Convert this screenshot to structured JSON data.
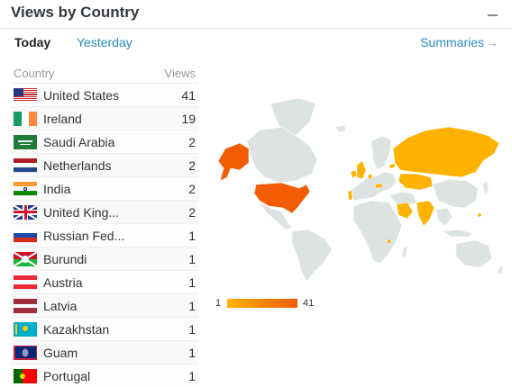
{
  "header": {
    "title": "Views by Country"
  },
  "tabs": [
    {
      "label": "Today",
      "active": true
    },
    {
      "label": "Yesterday",
      "active": false
    }
  ],
  "summaries_label": "Summaries",
  "table": {
    "columns": [
      "Country",
      "Views"
    ],
    "rows": [
      {
        "country": "United States",
        "views": "41",
        "flag": "us-flag-icon"
      },
      {
        "country": "Ireland",
        "views": "19",
        "flag": "ireland-flag-icon"
      },
      {
        "country": "Saudi Arabia",
        "views": "2",
        "flag": "saudi-arabia-flag-icon"
      },
      {
        "country": "Netherlands",
        "views": "2",
        "flag": "netherlands-flag-icon"
      },
      {
        "country": "India",
        "views": "2",
        "flag": "india-flag-icon"
      },
      {
        "country": "United King...",
        "views": "2",
        "flag": "uk-flag-icon"
      },
      {
        "country": "Russian Fed...",
        "views": "1",
        "flag": "russia-flag-icon"
      },
      {
        "country": "Burundi",
        "views": "1",
        "flag": "burundi-flag-icon"
      },
      {
        "country": "Austria",
        "views": "1",
        "flag": "austria-flag-icon"
      },
      {
        "country": "Latvia",
        "views": "1",
        "flag": "latvia-flag-icon"
      },
      {
        "country": "Kazakhstan",
        "views": "1",
        "flag": "kazakhstan-flag-icon"
      },
      {
        "country": "Guam",
        "views": "1",
        "flag": "guam-flag-icon"
      },
      {
        "country": "Portugal",
        "views": "1",
        "flag": "portugal-flag-icon"
      }
    ]
  },
  "legend": {
    "min": "1",
    "max": "41"
  },
  "colors": {
    "low": "#ffb200",
    "high": "#f25c05",
    "land": "#dde3e0",
    "link": "#2a8bbf"
  }
}
